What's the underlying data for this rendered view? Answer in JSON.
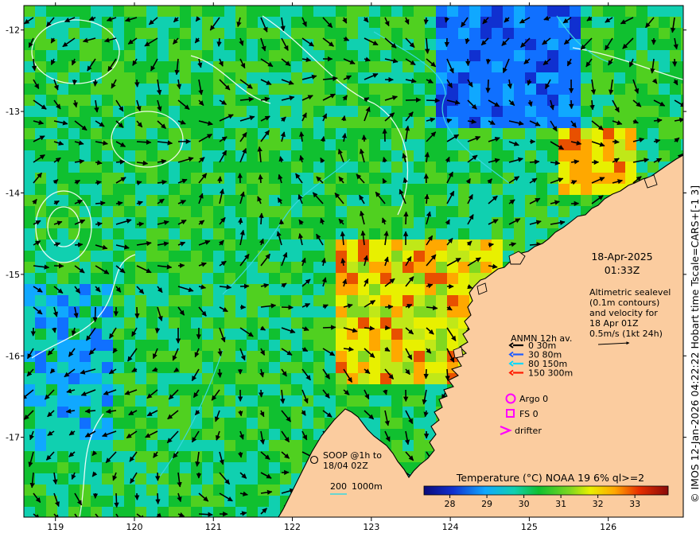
{
  "map": {
    "lon_ticks": [
      "119",
      "120",
      "121",
      "122",
      "123",
      "124",
      "125",
      "126"
    ],
    "lat_ticks": [
      "-12",
      "-13",
      "-14",
      "-15",
      "-16",
      "-17"
    ],
    "lon_range": [
      118.6,
      126.95
    ],
    "lat_range": [
      -17.98,
      -11.7
    ]
  },
  "timestamp": {
    "date": "18-Apr-2025",
    "time": "01:33Z"
  },
  "altimetry_note": {
    "line1": "Altimetric sealevel",
    "line2": "(0.1m contours)",
    "line3": "and velocity for",
    "line4": "18 Apr 01Z",
    "line5": "0.5m/s (1kt 24h)"
  },
  "anmn_legend": {
    "title": "ANMN 12h av.",
    "items": [
      {
        "label": "0 30m",
        "color": "#000000"
      },
      {
        "label": "30 80m",
        "color": "#1e5cff"
      },
      {
        "label": "80 150m",
        "color": "#00d8ff"
      },
      {
        "label": "150 300m",
        "color": "#ff1a00"
      }
    ]
  },
  "markers": {
    "argo": "Argo 0",
    "fs": "FS 0",
    "drifter": "drifter",
    "color": "#ff00ff"
  },
  "soop": {
    "line1": "SOOP @1h to",
    "line2": "18/04 02Z"
  },
  "bathymetry": {
    "label_a": "200",
    "label_b": "1000m"
  },
  "colorbar": {
    "title": "Temperature (°C) NOAA 19 6% ql>=2",
    "ticks": [
      "28",
      "29",
      "30",
      "31",
      "32",
      "33"
    ],
    "range": [
      27.3,
      33.9
    ]
  },
  "credit": "© IMOS 12-Jan-2026 04:22:22 Hobart time Tscale=CARS+[-1 3]",
  "colors": {
    "land": "#fbcc9f",
    "coast": "#000000",
    "contour": "#ffffff",
    "isobath": "#39d8e0"
  }
}
